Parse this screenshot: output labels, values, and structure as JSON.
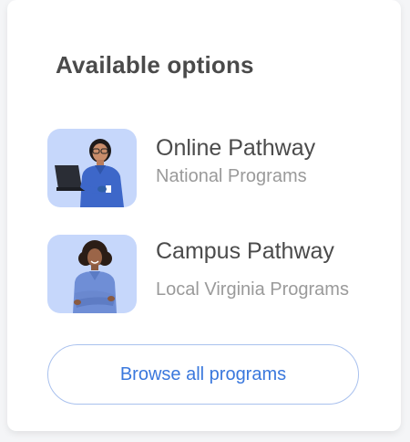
{
  "header": {
    "title": "Available options"
  },
  "options": [
    {
      "title": "Online Pathway",
      "subtitle": "National Programs",
      "image": "nurse-with-laptop-photo"
    },
    {
      "title": "Campus Pathway",
      "subtitle": "Local Virginia Programs",
      "image": "nurse-arms-crossed-photo"
    }
  ],
  "browse_button": {
    "label": "Browse all programs"
  },
  "colors": {
    "thumb_bg": "#c6d7fb",
    "accent": "#3a78dd",
    "button_border": "#a9c1ee",
    "scrub_blue": "#3d67c9"
  }
}
